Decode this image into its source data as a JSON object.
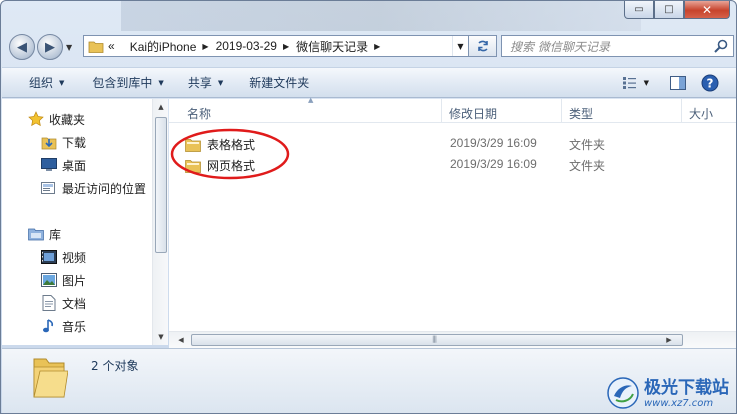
{
  "window": {
    "controls": {
      "minimize": "▭",
      "maximize": "□",
      "close": "✕"
    }
  },
  "navigation": {
    "back_glyph": "◀",
    "forward_glyph": "▶",
    "address": {
      "overflow": "«",
      "crumbs": [
        "Kai的iPhone",
        "2019-03-29",
        "微信聊天记录"
      ]
    },
    "search_placeholder": "搜索 微信聊天记录"
  },
  "toolbar": {
    "organize": "组织",
    "include_in_library": "包含到库中",
    "share": "共享",
    "new_folder": "新建文件夹",
    "icons": [
      "view-options-icon",
      "preview-pane-icon",
      "help-icon"
    ]
  },
  "sidebar": {
    "favorites": {
      "label": "收藏夹",
      "items": [
        {
          "label": "下载",
          "icon": "downloads-icon"
        },
        {
          "label": "桌面",
          "icon": "desktop-icon"
        },
        {
          "label": "最近访问的位置",
          "icon": "recent-places-icon"
        }
      ]
    },
    "libraries": {
      "label": "库",
      "items": [
        {
          "label": "视频",
          "icon": "video-icon"
        },
        {
          "label": "图片",
          "icon": "pictures-icon"
        },
        {
          "label": "文档",
          "icon": "documents-icon"
        },
        {
          "label": "音乐",
          "icon": "music-icon"
        }
      ]
    }
  },
  "file_list": {
    "columns": {
      "name": "名称",
      "date": "修改日期",
      "type": "类型",
      "size": "大小"
    },
    "rows": [
      {
        "name": "表格格式",
        "date": "2019/3/29 16:09",
        "type": "文件夹"
      },
      {
        "name": "网页格式",
        "date": "2019/3/29 16:09",
        "type": "文件夹"
      }
    ]
  },
  "details": {
    "count": "2 个对象"
  },
  "watermark": {
    "title": "极光下载站",
    "url": "www.xz7.com"
  },
  "colors": {
    "annotation_circle": "#e01b1b",
    "accent": "#2a67b8",
    "folder": "#e9c257"
  }
}
